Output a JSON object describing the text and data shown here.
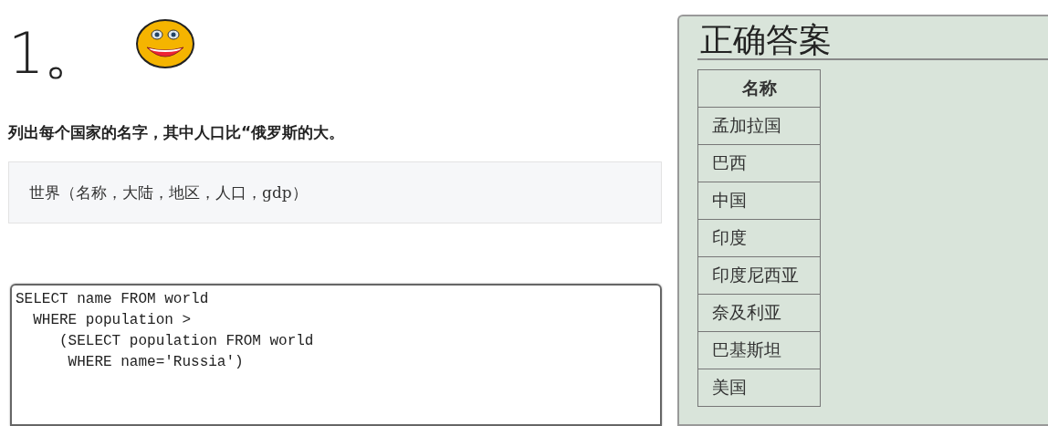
{
  "exercise": {
    "number": "1。",
    "question": "列出每个国家的名字，其中人口比“俄罗斯的大。",
    "schema": "世界（名称，大陆，地区，人口，gdp）",
    "code": "SELECT name FROM world\n  WHERE population >\n     (SELECT population FROM world\n      WHERE name='Russia')"
  },
  "answer": {
    "title": "正确答案",
    "columns": [
      "名称"
    ],
    "rows": [
      [
        "孟加拉国"
      ],
      [
        "巴西"
      ],
      [
        "中国"
      ],
      [
        "印度"
      ],
      [
        "印度尼西亚"
      ],
      [
        "奈及利亚"
      ],
      [
        "巴基斯坦"
      ],
      [
        "美国"
      ]
    ]
  }
}
